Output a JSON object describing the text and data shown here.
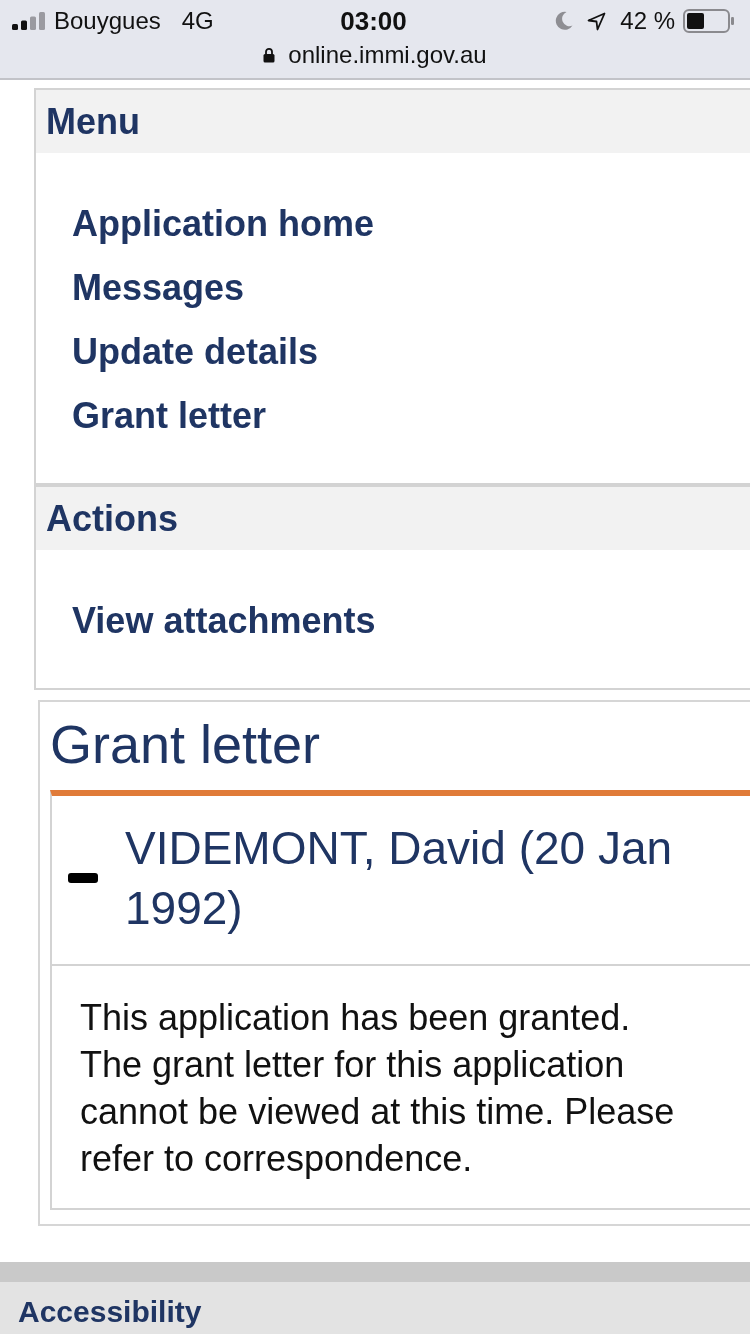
{
  "status_bar": {
    "carrier": "Bouygues",
    "network": "4G",
    "time": "03:00",
    "do_not_disturb": true,
    "location": true,
    "battery": "42 %"
  },
  "address_bar": {
    "url": "online.immi.gov.au",
    "secure": true
  },
  "panels": [
    {
      "title": "Menu",
      "links": [
        "Application home",
        "Messages",
        "Update details",
        "Grant letter"
      ]
    },
    {
      "title": "Actions",
      "links": [
        "View attachments"
      ]
    }
  ],
  "grant_letter": {
    "title": "Grant letter",
    "applicant": {
      "name": "VIDEMONT, David (20 Jan 1992)",
      "expanded": true,
      "message": "This application has been granted. The grant letter for this application cannot be viewed at this time. Please refer to correspondence."
    }
  },
  "footer": {
    "links": [
      "Accessibility"
    ]
  }
}
